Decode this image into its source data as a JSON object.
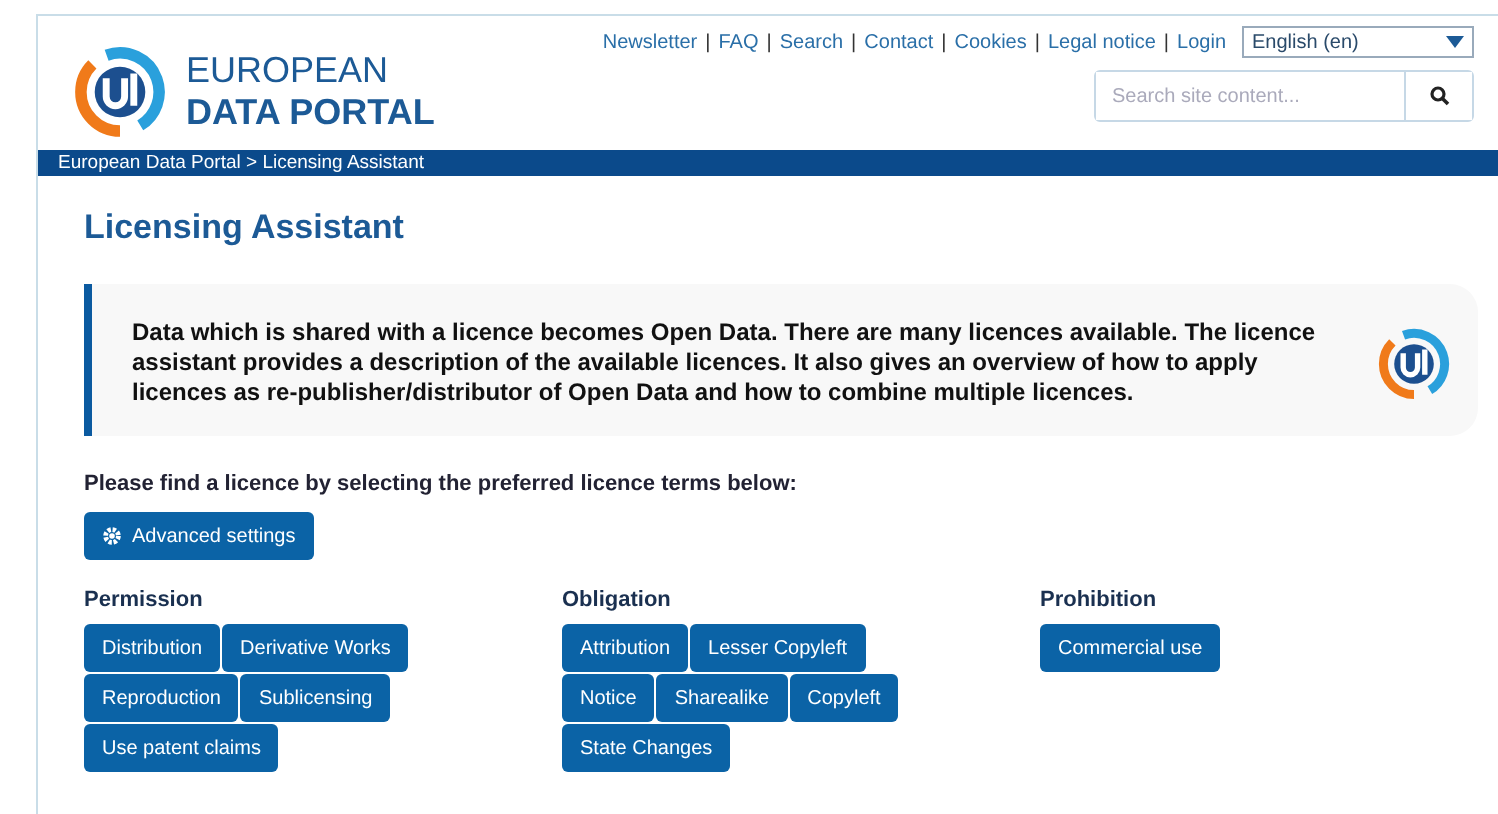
{
  "logo": {
    "line1": "EUROPEAN",
    "line2": "DATA PORTAL"
  },
  "top_links": [
    "Newsletter",
    "FAQ",
    "Search",
    "Contact",
    "Cookies",
    "Legal notice",
    "Login"
  ],
  "link_separator": "|",
  "language": {
    "value": "English (en)"
  },
  "search": {
    "placeholder": "Search site content..."
  },
  "breadcrumb": "European Data Portal > Licensing Assistant",
  "title": "Licensing Assistant",
  "intro": "Data which is shared with a licence becomes Open Data. There are many licences available. The licence assistant provides a description of the available licences. It also gives an overview of how to apply licences as re-publisher/distributor of Open Data and how to combine multiple licences.",
  "prompt": "Please find a licence by selecting the preferred licence terms below:",
  "advanced_button": "Advanced settings",
  "groups": [
    {
      "title": "Permission",
      "terms": [
        "Distribution",
        "Derivative Works",
        "Reproduction",
        "Sublicensing",
        "Use patent claims"
      ]
    },
    {
      "title": "Obligation",
      "terms": [
        "Attribution",
        "Lesser Copyleft",
        "Notice",
        "Sharealike",
        "Copyleft",
        "State Changes"
      ]
    },
    {
      "title": "Prohibition",
      "terms": [
        "Commercial use"
      ]
    }
  ]
}
